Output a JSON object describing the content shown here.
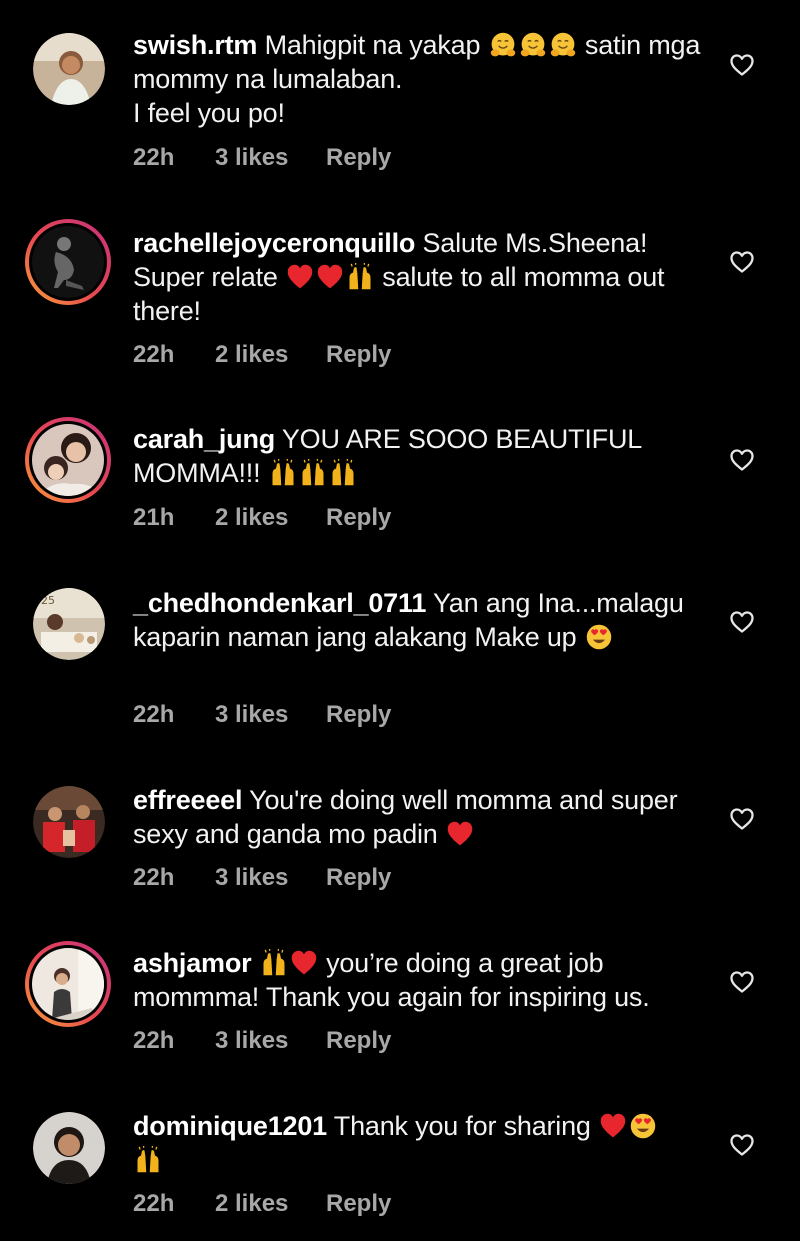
{
  "colors": {
    "background": "#000000",
    "text": "#f5f5f5",
    "meta": "#a8a8a8",
    "story_ring_start": "#f9a23a",
    "story_ring_end": "#c5307f"
  },
  "comments": [
    {
      "username": "swish.rtm",
      "text_parts": [
        "Mahigpit na yakap ",
        " satin mga mommy na lumalaban.",
        "I feel you po!"
      ],
      "emojis": [
        "hugging-face",
        "hugging-face",
        "hugging-face"
      ],
      "time": "22h",
      "likes": "3 likes",
      "reply": "Reply",
      "story_ring": false
    },
    {
      "username": "rachellejoyceronquillo",
      "text_parts": [
        "Salute Ms.Sheena! Super relate ",
        " salute to all momma out there!"
      ],
      "emojis": [
        "red-heart",
        "red-heart",
        "raising-hands"
      ],
      "time": "22h",
      "likes": "2 likes",
      "reply": "Reply",
      "story_ring": true
    },
    {
      "username": "carah_jung",
      "text_parts": [
        "YOU ARE SOOO BEAUTIFUL MOMMA!!! "
      ],
      "emojis": [
        "raising-hands",
        "raising-hands",
        "raising-hands"
      ],
      "time": "21h",
      "likes": "2 likes",
      "reply": "Reply",
      "story_ring": true
    },
    {
      "username": "_chedhondenkarl_0711",
      "text_parts": [
        "Yan ang Ina...malagu kaparin naman jang alakang Make up "
      ],
      "emojis": [
        "heart-eyes"
      ],
      "time": "22h",
      "likes": "3 likes",
      "reply": "Reply",
      "story_ring": false
    },
    {
      "username": "effreeeel",
      "text_parts": [
        "You're doing well momma and super sexy and ganda mo padin "
      ],
      "emojis": [
        "red-heart"
      ],
      "time": "22h",
      "likes": "3 likes",
      "reply": "Reply",
      "story_ring": false
    },
    {
      "username": "ashjamor",
      "text_parts": [
        " you’re doing a great job mommma! Thank you again for inspiring us."
      ],
      "emojis": [
        "raising-hands",
        "red-heart"
      ],
      "time": "22h",
      "likes": "3 likes",
      "reply": "Reply",
      "story_ring": true
    },
    {
      "username": "dominique1201",
      "text_parts": [
        "Thank you for sharing "
      ],
      "emojis": [
        "red-heart",
        "heart-eyes",
        "raising-hands"
      ],
      "time": "22h",
      "likes": "2 likes",
      "reply": "Reply",
      "story_ring": false
    }
  ]
}
